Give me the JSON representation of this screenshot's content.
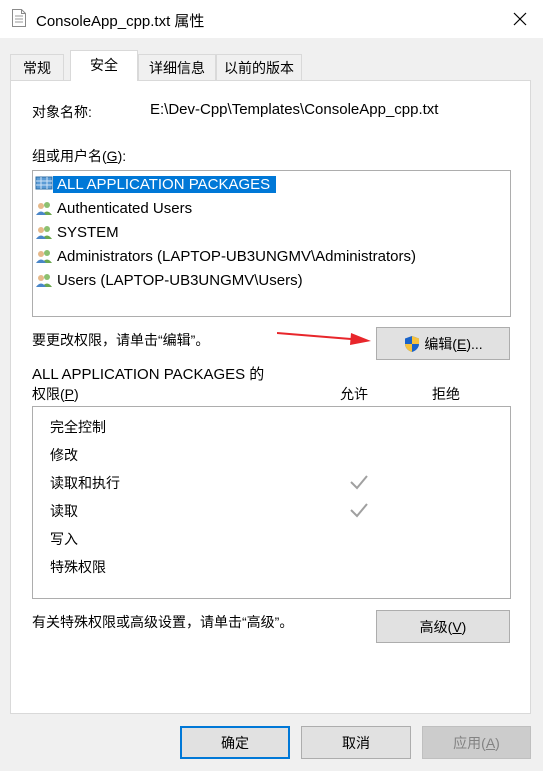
{
  "window": {
    "title": "ConsoleApp_cpp.txt 属性",
    "close_icon": "close-icon",
    "file_icon": "text-file-icon"
  },
  "tabs": [
    {
      "label": "常规",
      "active": false
    },
    {
      "label": "安全",
      "active": true
    },
    {
      "label": "详细信息",
      "active": false
    },
    {
      "label": "以前的版本",
      "active": false
    }
  ],
  "security": {
    "object_name_label": "对象名称:",
    "object_name_value": "E:\\Dev-Cpp\\Templates\\ConsoleApp_cpp.txt",
    "groups_label_pre": "组或用户名(",
    "groups_label_key": "G",
    "groups_label_post": "):",
    "groups": [
      {
        "name": "ALL APPLICATION PACKAGES",
        "icon": "app-packages-icon",
        "selected": true
      },
      {
        "name": "Authenticated Users",
        "icon": "users-group-icon",
        "selected": false
      },
      {
        "name": "SYSTEM",
        "icon": "users-group-icon",
        "selected": false
      },
      {
        "name": "Administrators (LAPTOP-UB3UNGMV\\Administrators)",
        "icon": "users-group-icon",
        "selected": false
      },
      {
        "name": "Users (LAPTOP-UB3UNGMV\\Users)",
        "icon": "users-group-icon",
        "selected": false
      }
    ],
    "edit_hint": "要更改权限，请单击“编辑”。",
    "edit_button_pre": "编辑(",
    "edit_button_key": "E",
    "edit_button_post": ")...",
    "perm_for_line1": "ALL APPLICATION PACKAGES 的",
    "perm_for_line2_pre": "权限(",
    "perm_for_line2_key": "P",
    "perm_for_line2_post": ")",
    "allow_header": "允许",
    "deny_header": "拒绝",
    "permissions": [
      {
        "name": "完全控制",
        "allow": false,
        "deny": false
      },
      {
        "name": "修改",
        "allow": false,
        "deny": false
      },
      {
        "name": "读取和执行",
        "allow": true,
        "deny": false
      },
      {
        "name": "读取",
        "allow": true,
        "deny": false
      },
      {
        "name": "写入",
        "allow": false,
        "deny": false
      },
      {
        "name": "特殊权限",
        "allow": false,
        "deny": false
      }
    ],
    "advanced_hint": "有关特殊权限或高级设置，请单击“高级”。",
    "advanced_button_pre": "高级(",
    "advanced_button_key": "V",
    "advanced_button_post": ")"
  },
  "footer": {
    "ok": "确定",
    "cancel": "取消",
    "apply_pre": "应用(",
    "apply_key": "A",
    "apply_post": ")"
  },
  "colors": {
    "selection": "#0078d7",
    "arrow": "#e8262b"
  }
}
